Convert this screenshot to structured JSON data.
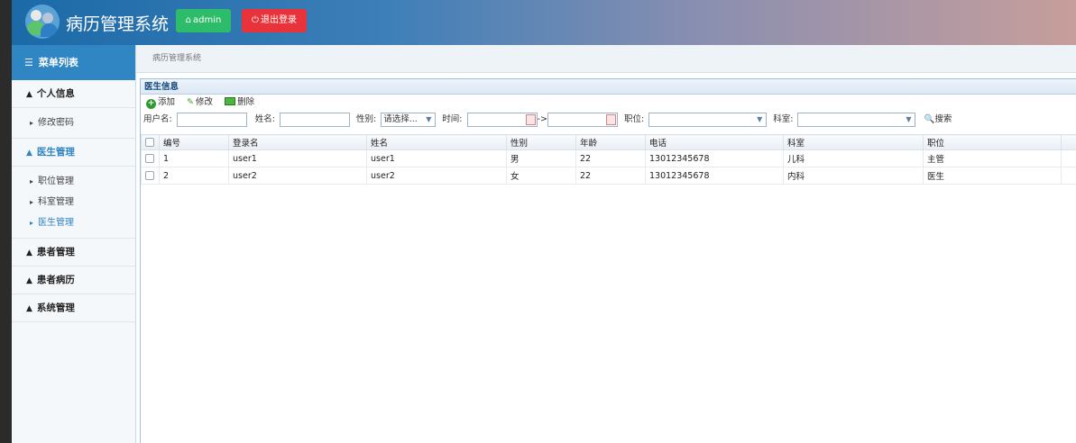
{
  "header": {
    "title": "病历管理系统",
    "user_label": "admin",
    "logout_label": "退出登录"
  },
  "sidebar": {
    "menu_title": "菜单列表",
    "items": [
      {
        "label": "个人信息",
        "children": [
          "修改密码"
        ]
      },
      {
        "label": "医生管理",
        "active": true,
        "children": [
          "职位管理",
          "科室管理",
          "医生管理"
        ]
      },
      {
        "label": "患者管理"
      },
      {
        "label": "患者病历"
      },
      {
        "label": "系统管理"
      }
    ]
  },
  "breadcrumb": "病历管理系统",
  "panel": {
    "title": "医生信息",
    "toolbar": {
      "add": "添加",
      "edit": "修改",
      "delete": "删除"
    },
    "filter": {
      "username_label": "用户名:",
      "name_label": "姓名:",
      "gender_label": "性别:",
      "gender_value": "请选择...",
      "time_label": "时间:",
      "time_sep": "->",
      "position_label": "职位:",
      "dept_label": "科室:",
      "search_label": "搜索"
    },
    "table": {
      "columns": [
        "编号",
        "登录名",
        "姓名",
        "性别",
        "年龄",
        "电话",
        "科室",
        "职位"
      ],
      "rows": [
        [
          "1",
          "user1",
          "user1",
          "男",
          "22",
          "13012345678",
          "儿科",
          "主管"
        ],
        [
          "2",
          "user2",
          "user2",
          "女",
          "22",
          "13012345678",
          "内科",
          "医生"
        ]
      ]
    }
  },
  "colors": {
    "accent": "#2f86c3",
    "admin_btn": "#2dbd6a",
    "logout_btn": "#e8333a"
  }
}
